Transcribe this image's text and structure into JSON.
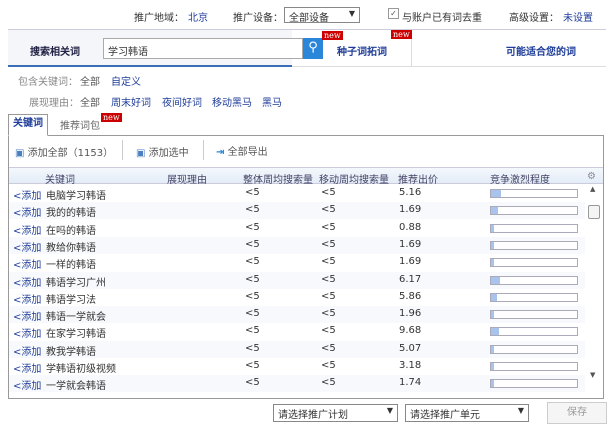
{
  "topbar": {
    "region_label": "推广地域：",
    "region_value": "北京",
    "device_label": "推广设备：",
    "device_value": "全部设备",
    "dedupe_label": "与账户已有词去重",
    "dedupe_checked": true,
    "advanced_label": "高级设置：",
    "advanced_value": "未设置"
  },
  "tabs": {
    "search_label": "搜索相关词",
    "search_value": "学习韩语",
    "seed_label": "种子词拓词",
    "suggest_label": "可能适合您的词",
    "new_badge": "new"
  },
  "filters": {
    "include_label": "包含关键词：",
    "include_options": [
      "全部",
      "自定义"
    ],
    "reason_label": "展现理由：",
    "reason_options": [
      "全部",
      "周末好词",
      "夜间好词",
      "移动黑马",
      "黑马"
    ]
  },
  "subtabs": {
    "keywords": "关键词",
    "packages": "推荐词包",
    "new_badge": "new"
  },
  "toolbar": {
    "add_all": "添加全部（1153）",
    "add_selected": "添加选中",
    "export_all": "全部导出"
  },
  "table": {
    "headers": [
      "关键词",
      "展现理由",
      "整体周均搜索量",
      "移动周均搜索量",
      "推荐出价",
      "竞争激烈程度"
    ],
    "add_label": "<添加",
    "rows": [
      {
        "keyword": "电脑学习韩语",
        "reason": "",
        "overall": "<5",
        "mobile": "<5",
        "bid": "5.16",
        "competition": 0.12
      },
      {
        "keyword": "我的的韩语",
        "reason": "",
        "overall": "<5",
        "mobile": "<5",
        "bid": "1.69",
        "competition": 0.08
      },
      {
        "keyword": "在吗的韩语",
        "reason": "",
        "overall": "<5",
        "mobile": "<5",
        "bid": "0.88",
        "competition": 0.03
      },
      {
        "keyword": "教给你韩语",
        "reason": "",
        "overall": "<5",
        "mobile": "<5",
        "bid": "1.69",
        "competition": 0.04
      },
      {
        "keyword": "一样的韩语",
        "reason": "",
        "overall": "<5",
        "mobile": "<5",
        "bid": "1.69",
        "competition": 0.04
      },
      {
        "keyword": "韩语学习广州",
        "reason": "",
        "overall": "<5",
        "mobile": "<5",
        "bid": "6.17",
        "competition": 0.1
      },
      {
        "keyword": "韩语学习法",
        "reason": "",
        "overall": "<5",
        "mobile": "<5",
        "bid": "5.86",
        "competition": 0.07
      },
      {
        "keyword": "韩语一学就会",
        "reason": "",
        "overall": "<5",
        "mobile": "<5",
        "bid": "1.96",
        "competition": 0.03
      },
      {
        "keyword": "在家学习韩语",
        "reason": "",
        "overall": "<5",
        "mobile": "<5",
        "bid": "9.68",
        "competition": 0.09
      },
      {
        "keyword": "教我学韩语",
        "reason": "",
        "overall": "<5",
        "mobile": "<5",
        "bid": "5.07",
        "competition": 0.04
      },
      {
        "keyword": "学韩语初级视频",
        "reason": "",
        "overall": "<5",
        "mobile": "<5",
        "bid": "3.18",
        "competition": 0.04
      },
      {
        "keyword": "一学就会韩语",
        "reason": "",
        "overall": "<5",
        "mobile": "<5",
        "bid": "1.74",
        "competition": 0.03
      }
    ]
  },
  "footer": {
    "plan_placeholder": "请选择推广计划",
    "unit_placeholder": "请选择推广单元",
    "save": "保存"
  }
}
